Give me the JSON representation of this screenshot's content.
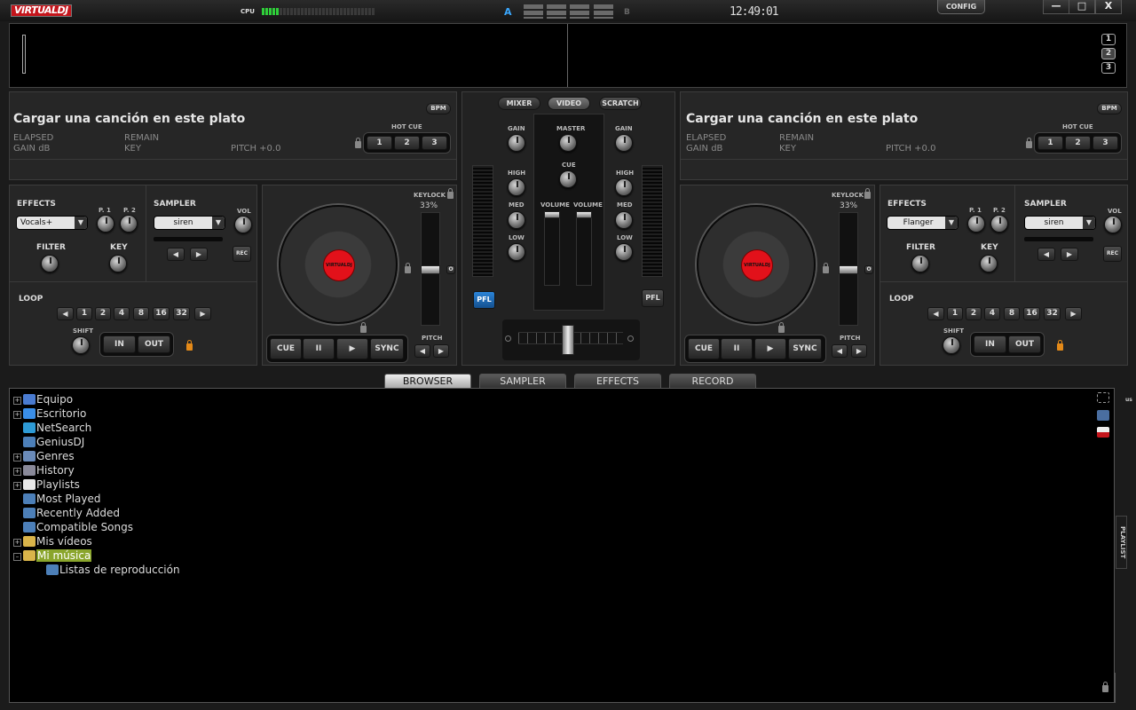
{
  "app": {
    "logo": "VIRTUALDJ",
    "cpu_label": "CPU",
    "cpu_on": 5,
    "cpu_total": 32,
    "a": "A",
    "b": "B",
    "clock": "12:49:01",
    "config": "CONFIG",
    "min": "—",
    "max": "□",
    "close": "X"
  },
  "wave": {
    "deck_buttons": [
      "1",
      "2",
      "3"
    ]
  },
  "deck_left": {
    "load_text": "Cargar una canción en este plato",
    "bpm": "BPM",
    "elapsed": "ELAPSED",
    "remain": "REMAIN",
    "gain": "GAIN dB",
    "key": "KEY",
    "pitch": "PITCH +0.0",
    "hot_cue": "HOT CUE",
    "hot_cues": [
      "1",
      "2",
      "3"
    ]
  },
  "deck_right": {
    "load_text": "Cargar una canción en este plato",
    "bpm": "BPM",
    "elapsed": "ELAPSED",
    "remain": "REMAIN",
    "gain": "GAIN dB",
    "key": "KEY",
    "pitch": "PITCH +0.0",
    "hot_cue": "HOT CUE",
    "hot_cues": [
      "1",
      "2",
      "3"
    ]
  },
  "fx_left": {
    "effects": "EFFECTS",
    "effect_value": "Vocals+",
    "p1": "P. 1",
    "p2": "P. 2",
    "sampler": "SAMPLER",
    "sample_value": "siren",
    "vol": "VOL",
    "rec": "REC",
    "filter": "FILTER",
    "key": "KEY",
    "loop": "LOOP",
    "loop_values": [
      "1",
      "2",
      "4",
      "8",
      "16",
      "32"
    ],
    "shift": "SHIFT",
    "in": "IN",
    "out": "OUT"
  },
  "fx_right": {
    "effects": "EFFECTS",
    "effect_value": "Flanger",
    "p1": "P. 1",
    "p2": "P. 2",
    "sampler": "SAMPLER",
    "sample_value": "siren",
    "vol": "VOL",
    "rec": "REC",
    "filter": "FILTER",
    "key": "KEY",
    "loop": "LOOP",
    "loop_values": [
      "1",
      "2",
      "4",
      "8",
      "16",
      "32"
    ],
    "shift": "SHIFT",
    "in": "IN",
    "out": "OUT"
  },
  "turntable": {
    "keylock": "KEYLOCK",
    "keylock_pct": "33%",
    "disc_label": "VIRTUALDJ",
    "cue": "CUE",
    "pause": "II",
    "play": "▶",
    "sync": "SYNC",
    "pitch": "PITCH",
    "zero": "O"
  },
  "mixer": {
    "tab_mixer": "MIXER",
    "tab_video": "VIDEO",
    "tab_scratch": "SCRATCH",
    "gain": "GAIN",
    "master": "MASTER",
    "cue": "CUE",
    "high": "HIGH",
    "med": "MED",
    "low": "LOW",
    "volume": "VOLUME",
    "pfl": "PFL"
  },
  "tabs": [
    "BROWSER",
    "SAMPLER",
    "EFFECTS",
    "RECORD"
  ],
  "tree": [
    {
      "label": "Equipo",
      "exp": "+",
      "icon": "computer-icon"
    },
    {
      "label": "Escritorio",
      "exp": "+",
      "icon": "desktop-icon"
    },
    {
      "label": "NetSearch",
      "exp": "",
      "icon": "globe-icon"
    },
    {
      "label": "GeniusDJ",
      "exp": "",
      "icon": "folder-icon"
    },
    {
      "label": "Genres",
      "exp": "+",
      "icon": "genres-icon"
    },
    {
      "label": "History",
      "exp": "+",
      "icon": "history-icon"
    },
    {
      "label": "Playlists",
      "exp": "+",
      "icon": "playlist-icon"
    },
    {
      "label": "Most Played",
      "exp": "",
      "icon": "folder-icon"
    },
    {
      "label": "Recently Added",
      "exp": "",
      "icon": "folder-icon"
    },
    {
      "label": "Compatible Songs",
      "exp": "",
      "icon": "folder-icon"
    },
    {
      "label": "Mis vídeos",
      "exp": "+",
      "icon": "video-folder-icon"
    },
    {
      "label": "Mi música",
      "exp": "–",
      "icon": "music-folder-icon"
    },
    {
      "label": "Listas de reproducción",
      "exp": "",
      "icon": "folder-icon"
    }
  ],
  "sidebar_tab": "PLAYLIST",
  "colors": {
    "accent": "#c4151c",
    "cpu_on": "#2fcf3a",
    "selection": "#8aa52c",
    "pfl": "#1e6bb8"
  }
}
